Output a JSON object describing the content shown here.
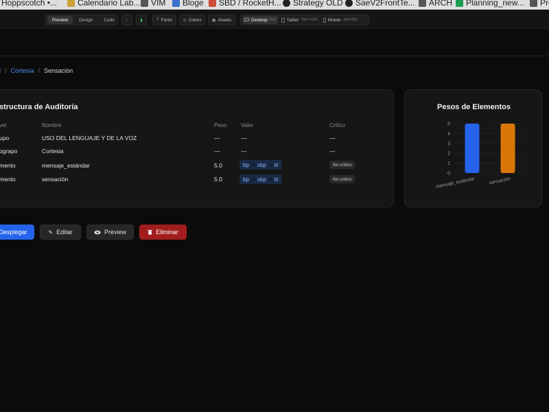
{
  "bookmarks": [
    {
      "label": "Hoppscotch •...",
      "icon": "hoppscotch-icon",
      "color": "#444444"
    },
    {
      "label": "Calendario Lab...",
      "icon": "calendar-icon",
      "color": "#c9a23a"
    },
    {
      "label": "VIM",
      "icon": "vim-icon",
      "color": "#555555"
    },
    {
      "label": "Bloge",
      "icon": "blog-icon",
      "color": "#3a6fd0"
    },
    {
      "label": "SBD / RocketH...",
      "icon": "rocket-icon",
      "color": "#d04a3a"
    },
    {
      "label": "Strategy OLD",
      "icon": "github-icon",
      "color": "#222222"
    },
    {
      "label": "SaeV2FrontTe...",
      "icon": "github-icon",
      "color": "#222222"
    },
    {
      "label": "ARCH",
      "icon": "folder-icon",
      "color": "#555555"
    },
    {
      "label": "Planning_new...",
      "icon": "sheets-icon",
      "color": "#1f9d55"
    },
    {
      "label": "Pro",
      "icon": "folder-icon",
      "color": "#555555"
    }
  ],
  "toolbar": {
    "view_modes": [
      "Preview",
      "Design",
      "Code"
    ],
    "active_view": "Preview",
    "fonts": "Fonts",
    "colors": "Colors",
    "assets": "Assets",
    "devices": [
      {
        "label": "Desktop",
        "detail": "Full",
        "active": true
      },
      {
        "label": "Tablet",
        "detail": "768×1024",
        "active": false
      },
      {
        "label": "Mobile",
        "detail": "393×852",
        "active": false
      }
    ]
  },
  "breadcrumb": {
    "first": "d",
    "second": "Cortesía",
    "current": "Sensación",
    "sep": "/"
  },
  "structure": {
    "title": "structura de Auditoría",
    "headers": {
      "nivel": "vel",
      "nombre": "Nombre",
      "peso": "Peso",
      "valor": "Valor",
      "critico": "Crítico"
    },
    "rows": [
      {
        "nivel": "upo",
        "nombre": "USO DEL LENGUAJE Y DE LA VOZ",
        "peso": "—",
        "valor": "—",
        "critico": "—",
        "tags": [],
        "badge": ""
      },
      {
        "nivel": "ograpo",
        "nombre": "Cortesia",
        "peso": "—",
        "valor": "—",
        "critico": "—",
        "tags": [],
        "badge": ""
      },
      {
        "nivel": "mento",
        "nombre": "mensaje_estándar",
        "peso": "5.0",
        "valor": "",
        "critico": "",
        "tags": [
          "bp",
          "sbp",
          "kl"
        ],
        "badge": "No crítico"
      },
      {
        "nivel": "mento",
        "nombre": "sensación",
        "peso": "5.0",
        "valor": "",
        "critico": "",
        "tags": [
          "bp",
          "sbp",
          "kl"
        ],
        "badge": "No crítico"
      }
    ]
  },
  "chart_data": {
    "type": "bar",
    "title": "Pesos de Elementos",
    "categories": [
      "mensaje_estándar",
      "sensación"
    ],
    "values": [
      5,
      5
    ],
    "colors": [
      "#2563eb",
      "#d97706"
    ],
    "ylim": [
      0,
      5
    ],
    "yticks": [
      "0",
      "1",
      "2",
      "3",
      "4",
      "5"
    ],
    "grid": true
  },
  "actions": {
    "deploy": "Desplegar",
    "edit": "Editar",
    "preview": "Preview",
    "delete": "Eliminar"
  },
  "colors": {
    "accent": "#2563eb",
    "danger": "#a11d1d",
    "link": "#4f8df5",
    "background": "#0b0b0b"
  }
}
